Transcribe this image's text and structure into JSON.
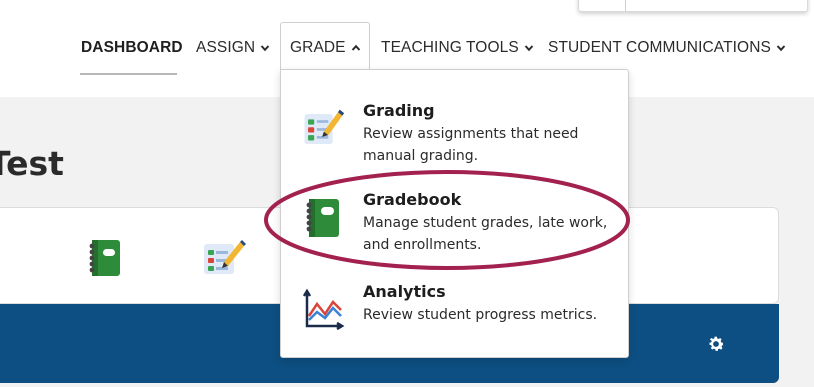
{
  "nav": {
    "items": [
      {
        "label": "DASHBOARD",
        "active": true,
        "has_chevron": false
      },
      {
        "label": "ASSIGN",
        "active": false,
        "has_chevron": true,
        "chevron": "chevron-down-icon"
      },
      {
        "label": "GRADE",
        "active": false,
        "has_chevron": true,
        "chevron": "chevron-up-icon",
        "open": true
      },
      {
        "label": "TEACHING TOOLS",
        "active": false,
        "has_chevron": true,
        "chevron": "chevron-down-icon"
      },
      {
        "label": "STUDENT COMMUNICATIONS",
        "active": false,
        "has_chevron": true,
        "chevron": "chevron-down-icon"
      }
    ]
  },
  "page": {
    "title": "Test"
  },
  "grade_menu": {
    "items": [
      {
        "title": "Grading",
        "description": "Review assignments that need manual grading.",
        "icon": "grading-checklist-icon"
      },
      {
        "title": "Gradebook",
        "description": "Manage student grades, late work, and enrollments.",
        "icon": "gradebook-icon",
        "highlighted": true
      },
      {
        "title": "Analytics",
        "description": "Review student progress metrics.",
        "icon": "analytics-chart-icon"
      }
    ]
  },
  "card": {
    "icons": [
      "gradebook-icon",
      "grading-checklist-icon"
    ],
    "footer_icon": "gear-icon"
  },
  "colors": {
    "banner_blue": "#0d4f82",
    "gradebook_green": "#2e8b3a",
    "highlight_ring": "#a3214f",
    "text_dark": "#222222"
  }
}
